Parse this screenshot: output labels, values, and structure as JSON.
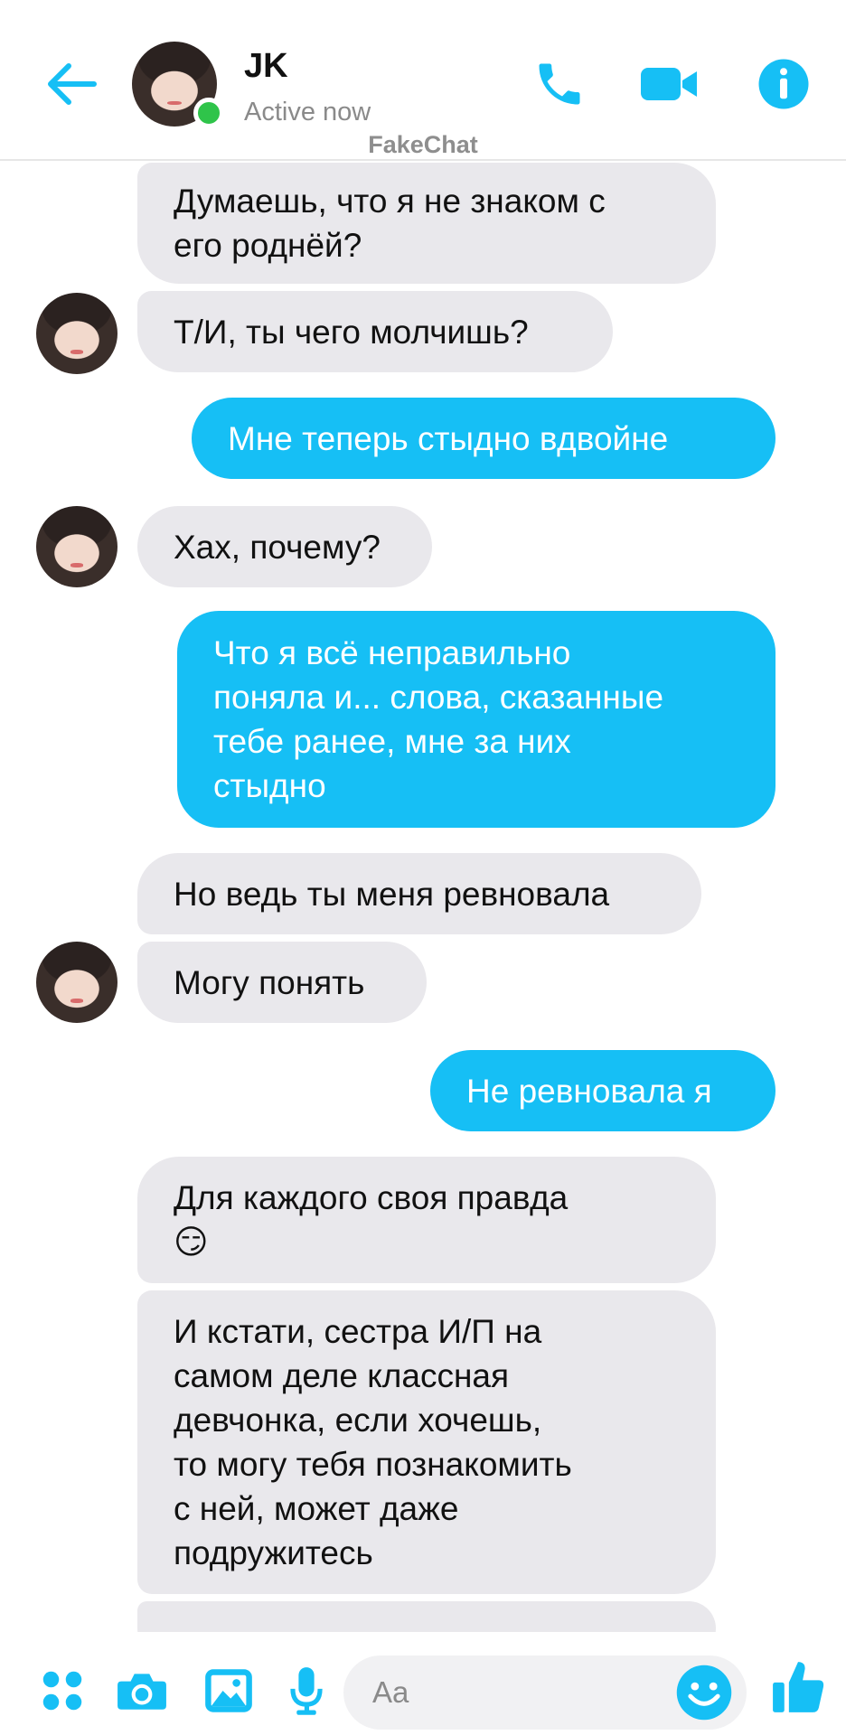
{
  "header": {
    "contact_name": "JK",
    "status": "Active now",
    "watermark": "FakeChat",
    "accent": "#16bff5"
  },
  "messages": [
    {
      "side": "in",
      "text": "Думаешь, что я не знаком с\nего роднёй?"
    },
    {
      "side": "in",
      "text": "Т/И, ты чего молчишь?"
    },
    {
      "side": "out",
      "text": "Мне теперь стыдно вдвойне"
    },
    {
      "side": "in",
      "text": "Хах, почему?"
    },
    {
      "side": "out",
      "text": "Что я всё неправильно\nпоняла и... слова, сказанные\nтебе ранее, мне за них\nстыдно"
    },
    {
      "side": "in",
      "text": "Но ведь ты меня ревновала"
    },
    {
      "side": "in",
      "text": "Могу понять"
    },
    {
      "side": "out",
      "text": "Не ревновала я"
    },
    {
      "side": "in",
      "text": "Для каждого своя правда\n😏"
    },
    {
      "side": "in",
      "text": "И кстати, сестра И/П на\nсамом деле классная\nдевчонка, если хочешь,\nто могу тебя познакомить\nс ней, может даже\nподружитесь"
    }
  ],
  "composer": {
    "placeholder": "Aa",
    "icons": [
      "apps-icon",
      "camera-icon",
      "gallery-icon",
      "microphone-icon",
      "emoji-icon",
      "thumbs-up-icon"
    ]
  }
}
